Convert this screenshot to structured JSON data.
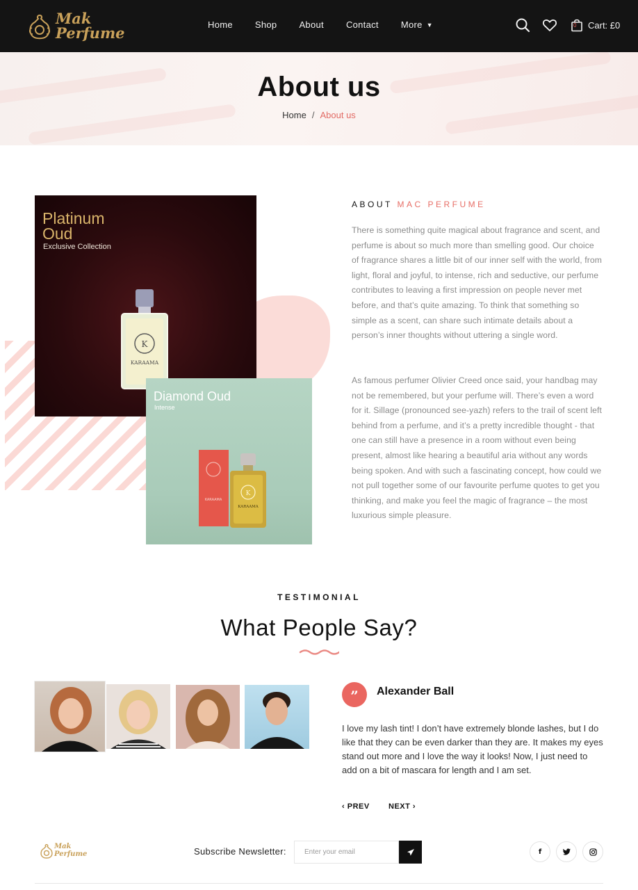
{
  "header": {
    "logo_text_line1": "Mak",
    "logo_text_line2": "Perfume",
    "nav": [
      "Home",
      "Shop",
      "About",
      "Contact",
      "More"
    ],
    "cart_count": "0",
    "cart_label": "Cart: £0",
    "icons": [
      "search-icon",
      "heart-icon",
      "shopping-bag-icon"
    ]
  },
  "page_title": {
    "title": "About us",
    "breadcrumb_home": "Home",
    "breadcrumb_separator": "/",
    "breadcrumb_current": "About us"
  },
  "about": {
    "heading_prefix": "ABOUT",
    "heading_accent": "MAC PERFUME",
    "paragraph1": "There is something quite magical about fragrance and scent, and perfume is about so much more than smelling good. Our choice of fragrance shares a little bit of our inner self with the world, from light, floral and joyful, to intense, rich and seductive, our perfume contributes to leaving a first impression on people never met before, and that’s quite amazing. To think that something so simple as a scent, can share such intimate details about a person’s inner thoughts without uttering a single word.",
    "paragraph2": "As famous perfumer Olivier Creed once said, your handbag may not be remembered, but your perfume will. There’s even a word for it. Sillage (pronounced see-yazh) refers to the trail of scent left behind from a perfume, and it’s a pretty incredible thought - that one can still have a presence in a room without even being present, almost like hearing a beautiful aria without any words being spoken. And with such a fascinating concept, how could we not pull together some of our favourite perfume quotes to get you thinking, and make you feel the magic of fragrance – the most luxurious simple pleasure.",
    "image1": {
      "title_line1": "Platinum",
      "title_line2": "Oud",
      "subtitle": "Exclusive Collection",
      "bottle_label": "KARAAMA"
    },
    "image2": {
      "title": "Diamond Oud",
      "subtitle": "Intense",
      "bottle_label": "KARAAMA"
    }
  },
  "testimonial": {
    "eyebrow": "TESTIMONIAL",
    "title": "What People Say?",
    "reviewer": "Alexander Ball",
    "quote_mark": "”",
    "text": "I love my lash tint! I don’t have extremely blonde lashes, but I do like that they can be even darker than they are. It makes my eyes stand out more and I love the way it looks! Now, I just need to add on a bit of mascara for length and I am set.",
    "prev": "PREV",
    "next": "NEXT"
  },
  "footer": {
    "logo_text_line1": "Mak",
    "logo_text_line2": "Perfume",
    "newsletter_label": "Subscribe Newsletter:",
    "email_placeholder": "Enter your email",
    "social": [
      "f",
      "t",
      "ig"
    ]
  },
  "colors": {
    "header_bg": "#141414",
    "accent": "#e76e66",
    "gold": "#c9a15a",
    "pink_soft": "#fbdcd8"
  }
}
